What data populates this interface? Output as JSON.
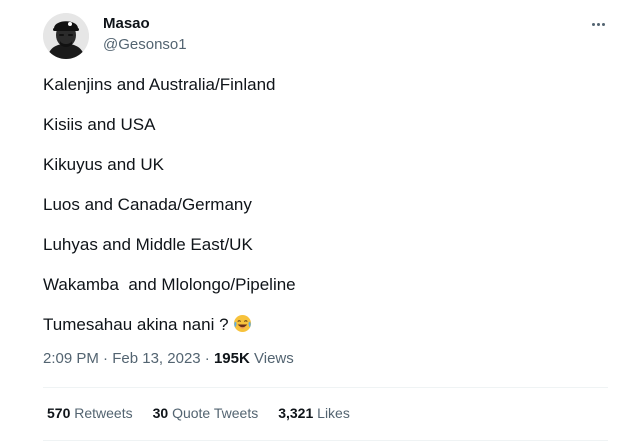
{
  "author": {
    "display_name": "Masao",
    "handle": "@Gesonso1"
  },
  "tweet": {
    "lines": [
      "Kalenjins and Australia/Finland",
      "Kisiis and USA",
      "Kikuyus and UK",
      "Luos and Canada/Germany",
      "Luhyas and Middle East/UK",
      "Wakamba  and Mlolongo/Pipeline",
      "Tumesahau akina nani ?"
    ],
    "emoji": "face-with-tears-of-joy"
  },
  "meta": {
    "time": "2:09 PM",
    "separator": "·",
    "date": "Feb 13, 2023",
    "views_count": "195K",
    "views_label": "Views"
  },
  "stats": {
    "retweets_count": "570",
    "retweets_label": "Retweets",
    "quotes_count": "30",
    "quotes_label": "Quote Tweets",
    "likes_count": "3,321",
    "likes_label": "Likes"
  },
  "icons": {
    "more": "more-horizontal-icon",
    "emoji": "laughing-emoji-icon"
  },
  "colors": {
    "text": "#0f1419",
    "secondary": "#536471",
    "divider": "#eff3f4"
  }
}
